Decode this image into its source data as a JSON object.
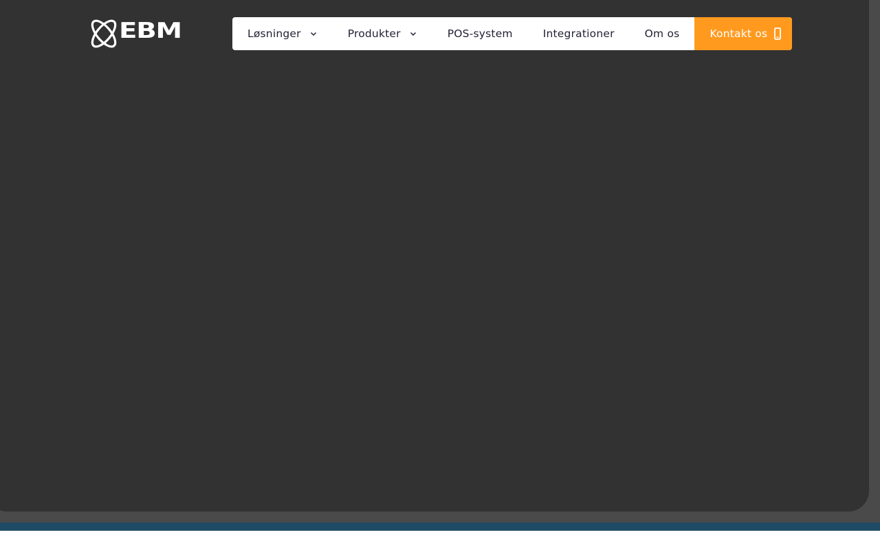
{
  "brand": {
    "name": "EBM",
    "logo_icon": "atom-logo-icon"
  },
  "nav": {
    "items": [
      {
        "label": "Løsninger",
        "has_dropdown": true,
        "icon": "chevron-down-icon"
      },
      {
        "label": "Produkter",
        "has_dropdown": true,
        "icon": "chevron-down-icon"
      },
      {
        "label": "POS-system",
        "has_dropdown": false
      },
      {
        "label": "Integrationer",
        "has_dropdown": false
      },
      {
        "label": "Om os",
        "has_dropdown": false
      }
    ],
    "cta": {
      "label": "Kontakt os",
      "icon": "phone-icon"
    }
  },
  "colors": {
    "hero_background": "#323232",
    "page_background": "#4a4a4a",
    "nav_background": "#ffffff",
    "nav_text": "#1f1f33",
    "cta_background": "#ff9a1f",
    "cta_text": "#ffffff",
    "footer_band": "#1e4a66"
  }
}
